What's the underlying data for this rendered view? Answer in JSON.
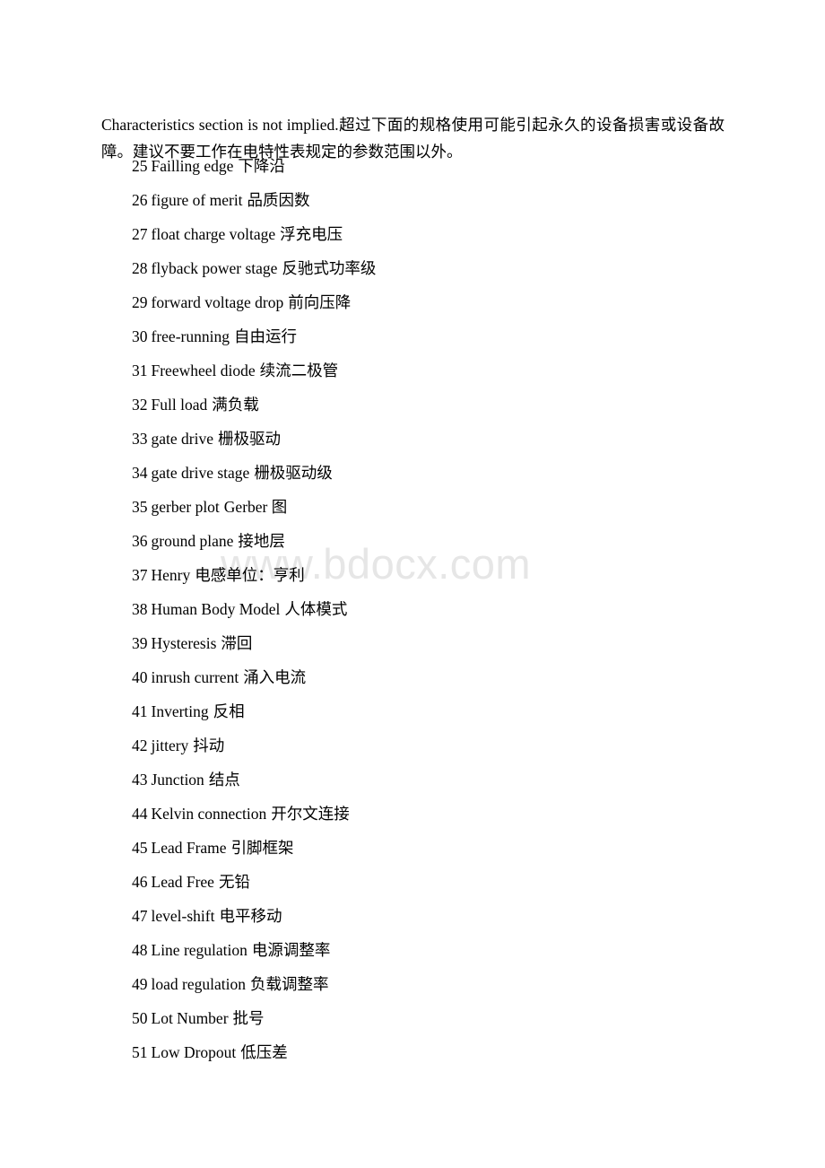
{
  "document": {
    "page_background": "#ffffff",
    "text_color": "#000000"
  },
  "watermark": {
    "text": "www.bdocx.com",
    "color": "#e6e6e6"
  },
  "intro": {
    "english": "Characteristics section is not implied.",
    "chinese": "超过下面的规格使用可能引起永久的设备损害或设备故障。建议不要工作在电特性表规定的参数范围以外。"
  },
  "glossary": {
    "items": [
      {
        "number": "25",
        "term": "Failling edge",
        "translation": "下降沿"
      },
      {
        "number": "26",
        "term": "figure of merit",
        "translation": "品质因数"
      },
      {
        "number": "27",
        "term": "float charge voltage",
        "translation": "浮充电压"
      },
      {
        "number": "28",
        "term": "flyback power stage",
        "translation": "反驰式功率级"
      },
      {
        "number": "29",
        "term": "forward voltage drop",
        "translation": "前向压降"
      },
      {
        "number": "30",
        "term": "free-running",
        "translation": "自由运行"
      },
      {
        "number": "31",
        "term": "Freewheel diode",
        "translation": "续流二极管"
      },
      {
        "number": "32",
        "term": "Full load",
        "translation": "满负载"
      },
      {
        "number": "33",
        "term": "gate drive",
        "translation": "栅极驱动"
      },
      {
        "number": "34",
        "term": "gate drive stage",
        "translation": "栅极驱动级"
      },
      {
        "number": "35",
        "term": "gerber plot",
        "translation": "Gerber 图"
      },
      {
        "number": "36",
        "term": "ground plane",
        "translation": "接地层"
      },
      {
        "number": "37",
        "term": "Henry",
        "translation": "电感单位：亨利"
      },
      {
        "number": "38",
        "term": "Human Body Model",
        "translation": "人体模式"
      },
      {
        "number": "39",
        "term": "Hysteresis",
        "translation": "滞回"
      },
      {
        "number": "40",
        "term": "inrush current",
        "translation": "涌入电流"
      },
      {
        "number": "41",
        "term": "Inverting",
        "translation": "反相"
      },
      {
        "number": "42",
        "term": "jittery",
        "translation": "抖动"
      },
      {
        "number": "43",
        "term": "Junction",
        "translation": "结点"
      },
      {
        "number": "44",
        "term": "Kelvin connection",
        "translation": "开尔文连接"
      },
      {
        "number": "45",
        "term": "Lead Frame",
        "translation": "引脚框架"
      },
      {
        "number": "46",
        "term": "Lead Free",
        "translation": "无铅"
      },
      {
        "number": "47",
        "term": "level-shift",
        "translation": "电平移动"
      },
      {
        "number": "48",
        "term": "Line regulation",
        "translation": "电源调整率"
      },
      {
        "number": "49",
        "term": "load regulation",
        "translation": "负载调整率"
      },
      {
        "number": "50",
        "term": "Lot Number",
        "translation": "批号"
      },
      {
        "number": "51",
        "term": "Low Dropout",
        "translation": "低压差"
      }
    ]
  }
}
